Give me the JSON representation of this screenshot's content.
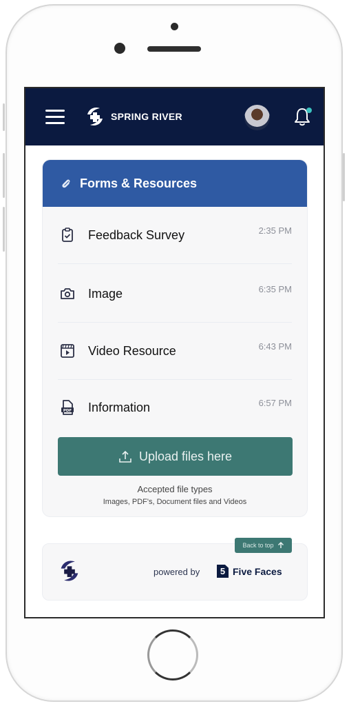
{
  "header": {
    "brand": "SPRING RIVER",
    "menu_icon": "hamburger-menu-icon",
    "avatar": "user-avatar",
    "notification_icon": "bell-icon",
    "notification_dot_color": "#3cc3c0",
    "background_color": "#0b1a40"
  },
  "forms": {
    "title": "Forms & Resources",
    "title_icon": "paperclip-icon",
    "header_color": "#2f5aa3",
    "items": [
      {
        "label": "Feedback Survey",
        "time": "2:35 PM",
        "icon": "clipboard-check-icon"
      },
      {
        "label": "Image",
        "time": "6:35 PM",
        "icon": "camera-icon"
      },
      {
        "label": "Video Resource",
        "time": "6:43 PM",
        "icon": "video-clapper-icon"
      },
      {
        "label": "Information",
        "time": "6:57 PM",
        "icon": "pdf-file-icon"
      }
    ],
    "upload_label": "Upload files here",
    "upload_icon": "upload-icon",
    "upload_color": "#3d7873",
    "accepted_title": "Accepted file types",
    "accepted_types": "Images, PDF's, Document files and Videos"
  },
  "footer": {
    "back_to_top": "Back to top",
    "powered_by": "powered by",
    "partner_badge": "5",
    "partner_name": "Five Faces"
  }
}
